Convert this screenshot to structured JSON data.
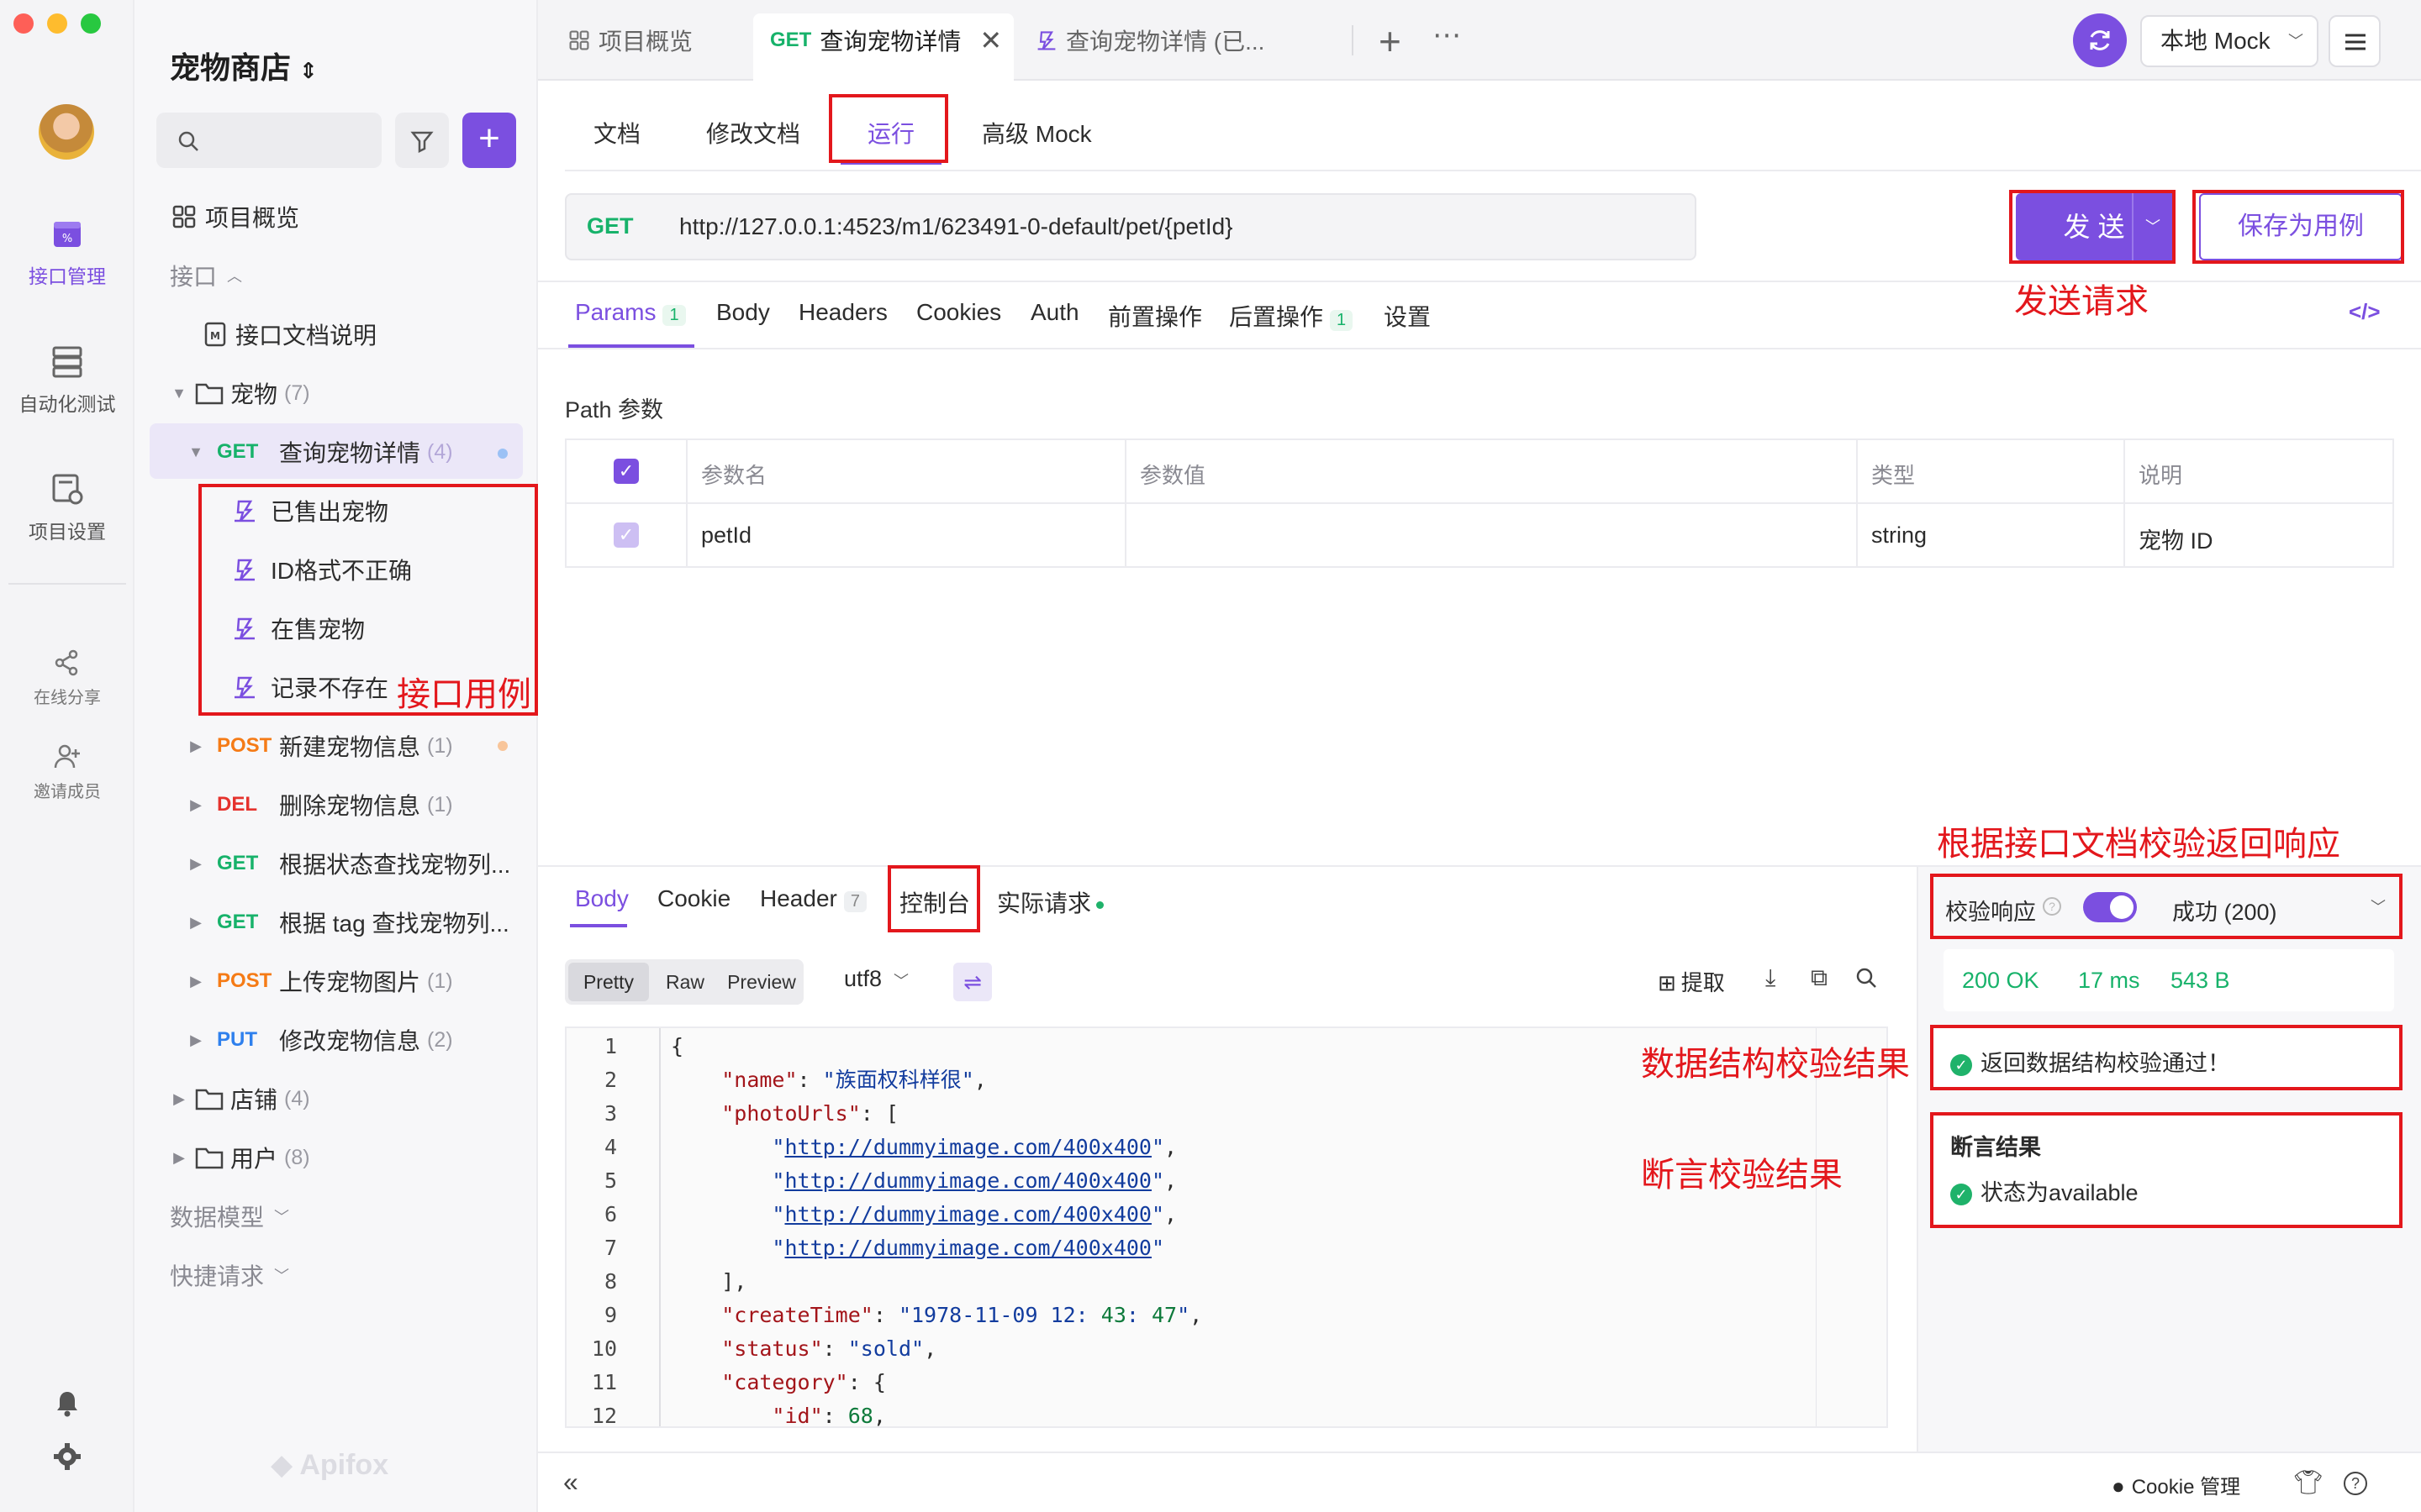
{
  "rail": {
    "items": [
      {
        "label": "接口管理"
      },
      {
        "label": "自动化测试"
      },
      {
        "label": "项目设置"
      },
      {
        "label": "在线分享"
      },
      {
        "label": "邀请成员"
      }
    ]
  },
  "sidebar": {
    "project": "宠物商店",
    "overview": "项目概览",
    "api_section": "接口",
    "doc_item": "接口文档说明",
    "folder_pets": {
      "label": "宠物",
      "count": "(7)"
    },
    "active_api": {
      "method": "GET",
      "label": "查询宠物详情",
      "count": "(4)"
    },
    "cases": [
      "已售出宠物",
      "ID格式不正确",
      "在售宠物",
      "记录不存在"
    ],
    "apis": [
      {
        "method": "POST",
        "label": "新建宠物信息",
        "count": "(1)"
      },
      {
        "method": "DEL",
        "label": "删除宠物信息",
        "count": "(1)"
      },
      {
        "method": "GET",
        "label": "根据状态查找宠物列...",
        "count": ""
      },
      {
        "method": "GET",
        "label": "根据 tag 查找宠物列...",
        "count": ""
      },
      {
        "method": "POST",
        "label": "上传宠物图片",
        "count": "(1)"
      },
      {
        "method": "PUT",
        "label": "修改宠物信息",
        "count": "(2)"
      }
    ],
    "folders": [
      {
        "label": "店铺",
        "count": "(4)"
      },
      {
        "label": "用户",
        "count": "(8)"
      }
    ],
    "data_models": "数据模型",
    "quick_requests": "快捷请求",
    "brand": "Apifox"
  },
  "tabs": [
    {
      "label": "项目概览"
    },
    {
      "method": "GET",
      "label": "查询宠物详情"
    },
    {
      "label": "查询宠物详情 (已..."
    }
  ],
  "env": {
    "label": "本地 Mock"
  },
  "subtabs": [
    "文档",
    "修改文档",
    "运行",
    "高级 Mock"
  ],
  "request": {
    "method": "GET",
    "url": "http://127.0.0.1:4523/m1/623491-0-default/pet/{petId}",
    "send": "发 送",
    "save_case": "保存为用例"
  },
  "param_tabs": [
    {
      "label": "Params",
      "badge": "1"
    },
    {
      "label": "Body",
      "badge": ""
    },
    {
      "label": "Headers",
      "badge": ""
    },
    {
      "label": "Cookies",
      "badge": ""
    },
    {
      "label": "Auth",
      "badge": ""
    },
    {
      "label": "前置操作",
      "badge": ""
    },
    {
      "label": "后置操作",
      "badge": "1"
    },
    {
      "label": "设置",
      "badge": ""
    }
  ],
  "path_params": {
    "title": "Path 参数",
    "headers": [
      "参数名",
      "参数值",
      "类型",
      "说明"
    ],
    "rows": [
      {
        "name": "petId",
        "value": "",
        "type": "string",
        "desc": "宠物 ID"
      }
    ]
  },
  "response": {
    "tabs": [
      {
        "label": "Body",
        "badge": ""
      },
      {
        "label": "Cookie",
        "badge": ""
      },
      {
        "label": "Header",
        "badge": "7"
      },
      {
        "label": "控制台",
        "badge": ""
      },
      {
        "label": "实际请求",
        "badge": ""
      }
    ],
    "views": [
      "Pretty",
      "Raw",
      "Preview"
    ],
    "encoding": "utf8",
    "extract": "提取",
    "code_lines": [
      "{",
      "    \"name\": \"族面权科样很\",",
      "    \"photoUrls\": [",
      "        \"http://dummyimage.com/400x400\",",
      "        \"http://dummyimage.com/400x400\",",
      "        \"http://dummyimage.com/400x400\",",
      "        \"http://dummyimage.com/400x400\"",
      "    ],",
      "    \"createTime\": \"1978-11-09 12:43:47\",",
      "    \"status\": \"sold\",",
      "    \"category\": {",
      "        \"id\": 68,"
    ]
  },
  "validation": {
    "label": "校验响应",
    "result": "成功 (200)",
    "status": "200 OK",
    "time": "17 ms",
    "size": "543 B",
    "schema_ok": "返回数据结构校验通过！",
    "assert_title": "断言结果",
    "assert_item": "状态为available"
  },
  "annotations": {
    "cases": "接口用例",
    "send": "发送请求",
    "validate": "根据接口文档校验返回响应",
    "schema": "数据结构校验结果",
    "assert": "断言校验结果"
  },
  "footer": {
    "cookie": "Cookie 管理"
  },
  "colors": {
    "accent": "#7b4fe0",
    "get": "#17b26a",
    "post": "#f57b16",
    "del": "#e5322d",
    "put": "#2f80ed",
    "annotation": "#e3171c"
  }
}
